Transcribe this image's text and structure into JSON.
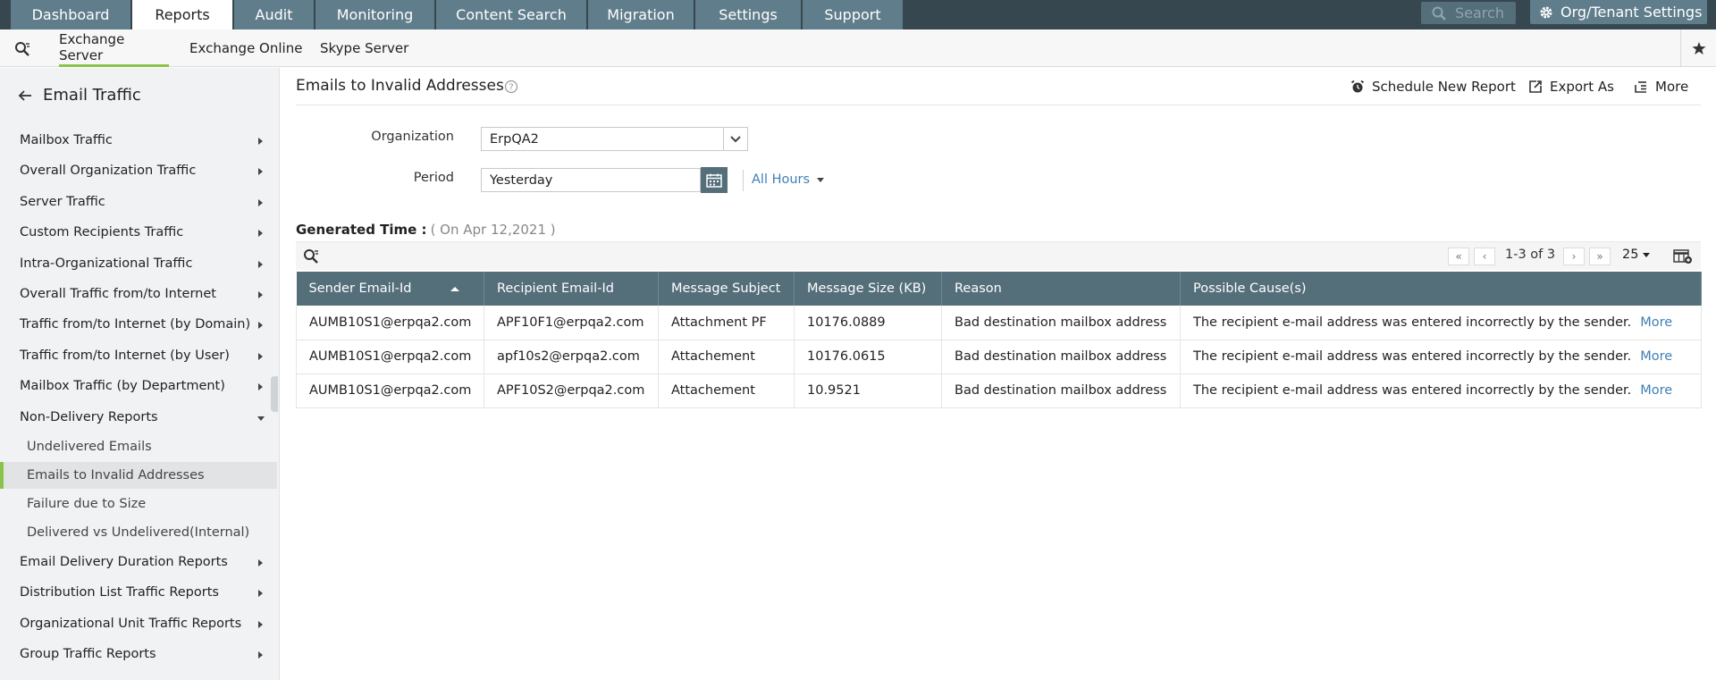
{
  "topnav": {
    "tabs": [
      {
        "label": "Dashboard",
        "active": false
      },
      {
        "label": "Reports",
        "active": true
      },
      {
        "label": "Audit",
        "active": false
      },
      {
        "label": "Monitoring",
        "active": false
      },
      {
        "label": "Content Search",
        "active": false
      },
      {
        "label": "Migration",
        "active": false
      },
      {
        "label": "Settings",
        "active": false
      },
      {
        "label": "Support",
        "active": false
      }
    ],
    "search_placeholder": "Search",
    "org_settings_label": "Org/Tenant Settings"
  },
  "subnav": {
    "tabs": [
      {
        "label": "Exchange Server",
        "active": true
      },
      {
        "label": "Exchange Online",
        "active": false
      },
      {
        "label": "Skype Server",
        "active": false
      }
    ]
  },
  "sidebar": {
    "title": "Email Traffic",
    "items": [
      {
        "label": "Mailbox Traffic"
      },
      {
        "label": "Overall Organization Traffic"
      },
      {
        "label": "Server Traffic"
      },
      {
        "label": "Custom Recipients Traffic"
      },
      {
        "label": "Intra-Organizational Traffic"
      },
      {
        "label": "Overall Traffic from/to Internet"
      },
      {
        "label": "Traffic from/to Internet (by Domain)"
      },
      {
        "label": "Traffic from/to Internet (by User)"
      },
      {
        "label": "Mailbox Traffic (by Department)"
      },
      {
        "label": "Non-Delivery Reports"
      }
    ],
    "subitems": [
      {
        "label": "Undelivered Emails",
        "active": false
      },
      {
        "label": "Emails to Invalid Addresses",
        "active": true
      },
      {
        "label": "Failure due to Size",
        "active": false
      },
      {
        "label": "Delivered vs Undelivered(Internal)",
        "active": false
      }
    ],
    "items_after": [
      {
        "label": "Email Delivery Duration Reports"
      },
      {
        "label": "Distribution List Traffic Reports"
      },
      {
        "label": "Organizational Unit Traffic Reports"
      },
      {
        "label": "Group Traffic Reports"
      }
    ]
  },
  "main": {
    "title": "Emails to Invalid Addresses",
    "actions": {
      "schedule": "Schedule New Report",
      "export": "Export As",
      "more": "More"
    },
    "form": {
      "organization_label": "Organization",
      "organization_value": "ErpQA2",
      "period_label": "Period",
      "period_value": "Yesterday",
      "hours_label": "All Hours"
    },
    "generated": {
      "label": "Generated Time :",
      "value": "( On Apr 12,2021 )"
    },
    "pagination": {
      "range": "1-3 of 3",
      "page_size": "25"
    },
    "table": {
      "columns": [
        "Sender Email-Id",
        "Recipient Email-Id",
        "Message Subject",
        "Message Size (KB)",
        "Reason",
        "Possible Cause(s)"
      ],
      "more_label": "More",
      "rows": [
        [
          "AUMB10S1@erpqa2.com",
          "APF10F1@erpqa2.com",
          "Attachment PF",
          "10176.0889",
          "Bad destination mailbox address",
          "The recipient e-mail address was entered incorrectly by the sender."
        ],
        [
          "AUMB10S1@erpqa2.com",
          "apf10s2@erpqa2.com",
          "Attachement",
          "10176.0615",
          "Bad destination mailbox address",
          "The recipient e-mail address was entered incorrectly by the sender."
        ],
        [
          "AUMB10S1@erpqa2.com",
          "APF10S2@erpqa2.com",
          "Attachement",
          "10.9521",
          "Bad destination mailbox address",
          "The recipient e-mail address was entered incorrectly by the sender."
        ]
      ]
    }
  }
}
